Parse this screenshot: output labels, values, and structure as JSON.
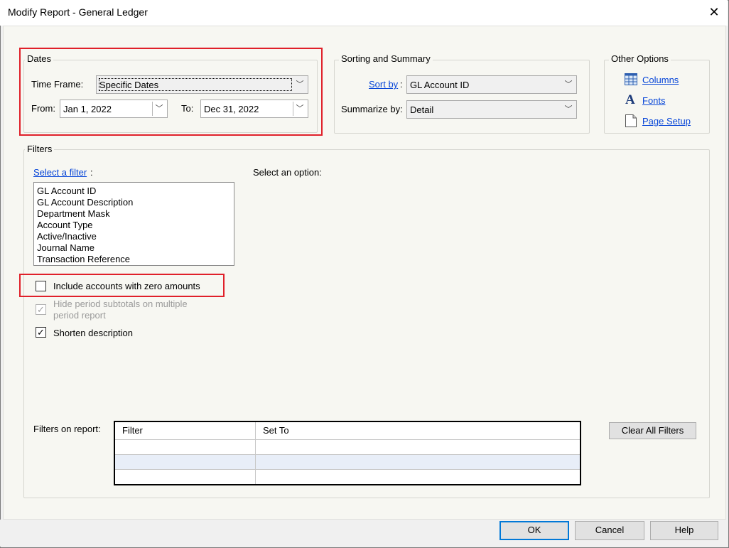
{
  "window": {
    "title": "Modify Report - General Ledger",
    "close_glyph": "✕"
  },
  "dates": {
    "legend": "Dates",
    "time_frame_label": "Time Frame:",
    "time_frame_value": "Specific Dates",
    "from_label": "From:",
    "from_value": "Jan 1, 2022",
    "to_label": "To:",
    "to_value": "Dec 31, 2022"
  },
  "sorting": {
    "legend": "Sorting and Summary",
    "sort_by_label": "Sort by",
    "sort_by_colon": ":",
    "sort_by_value": "GL Account ID",
    "summarize_label": "Summarize by:",
    "summarize_value": "Detail"
  },
  "other_options": {
    "legend": "Other Options",
    "columns": "Columns",
    "fonts": "Fonts",
    "page_setup": "Page Setup",
    "fonts_icon_glyph": "A"
  },
  "filters": {
    "legend": "Filters",
    "select_filter_label": "Select a filter",
    "select_filter_colon": ":",
    "select_option_label": "Select an option:",
    "items": [
      "GL Account ID",
      "GL Account Description",
      "Department Mask",
      "Account Type",
      "Active/Inactive",
      "Journal Name",
      "Transaction Reference"
    ],
    "include_zero_label": "Include accounts with zero amounts",
    "include_zero_checked": false,
    "hide_subtotals_label_line1": "Hide period subtotals on multiple",
    "hide_subtotals_label_line2": "period report",
    "hide_subtotals_checked": true,
    "shorten_label": "Shorten description",
    "shorten_checked": true,
    "check_glyph": "✓",
    "filters_on_report_label": "Filters on report:",
    "grid_headers": [
      "Filter",
      "Set To"
    ],
    "clear_all_label": "Clear All Filters"
  },
  "footer": {
    "ok": "OK",
    "cancel": "Cancel",
    "help": "Help"
  },
  "colors": {
    "highlight_border": "#e0202a",
    "link": "#0645d8",
    "default_button_border": "#0078d7",
    "selected_row": "#e8eef8"
  },
  "icons": {
    "columns": "table-grid-icon",
    "fonts": "font-a-icon",
    "page_setup": "page-icon"
  }
}
